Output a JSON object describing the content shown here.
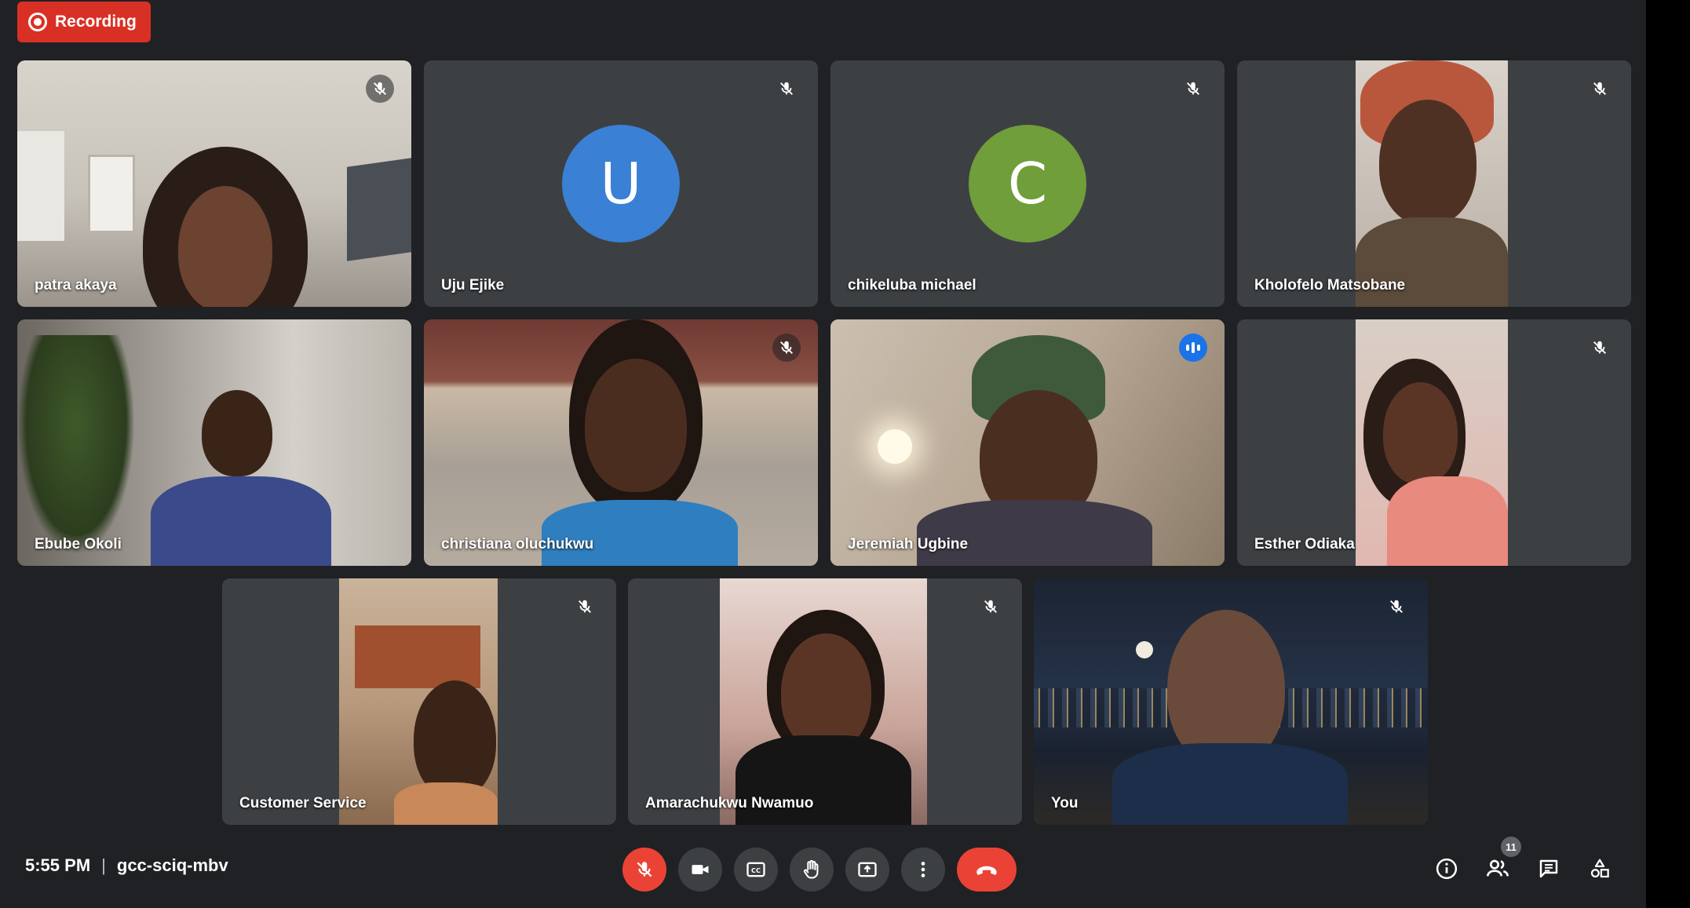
{
  "recording": {
    "label": "Recording"
  },
  "participants": [
    {
      "name": "patra akaya",
      "muted": true
    },
    {
      "name": "Uju Ejike",
      "initial": "U",
      "muted": true,
      "avatar_color": "#3a80d4"
    },
    {
      "name": "chikeluba michael",
      "initial": "C",
      "muted": true,
      "avatar_color": "#6f9e3a"
    },
    {
      "name": "Kholofelo Matsobane",
      "muted": true
    },
    {
      "name": "Ebube Okoli",
      "muted": false
    },
    {
      "name": "christiana oluchukwu",
      "muted": true
    },
    {
      "name": "Jeremiah Ugbine",
      "muted": false,
      "speaking": true
    },
    {
      "name": "Esther Odiaka",
      "muted": true
    },
    {
      "name": "Customer Service",
      "muted": true
    },
    {
      "name": "Amarachukwu Nwamuo",
      "muted": true
    },
    {
      "name": "You",
      "muted": true
    }
  ],
  "footer": {
    "time": "5:55 PM",
    "separator": "|",
    "meeting_code": "gcc-sciq-mbv",
    "participant_count": "11"
  },
  "controls": [
    "mic-off",
    "camera",
    "captions",
    "raise-hand",
    "present",
    "more-options",
    "leave-call"
  ],
  "right_icons": [
    "info",
    "people",
    "chat",
    "activities"
  ],
  "colors": {
    "background": "#202124",
    "tile": "#3c4043",
    "accent": "#8ab4f8",
    "danger": "#ea4335"
  }
}
